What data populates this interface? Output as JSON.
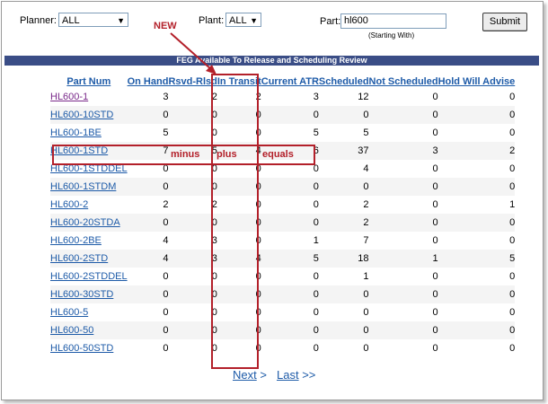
{
  "filters": {
    "planner_label": "Planner:",
    "planner_value": "ALL",
    "plant_label": "Plant:",
    "plant_value": "ALL",
    "part_label": "Part:",
    "part_value": "hl600",
    "part_hint": "(Starting With)",
    "submit_label": "Submit"
  },
  "banner": "FEG Available To Release and Scheduling Review",
  "columns": [
    "Part Num",
    "On Hand",
    "Rsvd-Rlsd",
    "In Transit",
    "Current ATR",
    "Scheduled",
    "Not Scheduled",
    "Hold Will Advise"
  ],
  "rows": [
    [
      "HL600-1",
      "3",
      "2",
      "2",
      "3",
      "12",
      "0",
      "0"
    ],
    [
      "HL600-10STD",
      "0",
      "0",
      "0",
      "0",
      "0",
      "0",
      "0"
    ],
    [
      "HL600-1BE",
      "5",
      "0",
      "0",
      "5",
      "5",
      "0",
      "0"
    ],
    [
      "HL600-1STD",
      "7",
      "5",
      "4",
      "6",
      "37",
      "3",
      "2"
    ],
    [
      "HL600-1STDDEL",
      "0",
      "0",
      "0",
      "0",
      "4",
      "0",
      "0"
    ],
    [
      "HL600-1STDM",
      "0",
      "0",
      "0",
      "0",
      "0",
      "0",
      "0"
    ],
    [
      "HL600-2",
      "2",
      "2",
      "0",
      "0",
      "2",
      "0",
      "1"
    ],
    [
      "HL600-20STDA",
      "0",
      "0",
      "0",
      "0",
      "2",
      "0",
      "0"
    ],
    [
      "HL600-2BE",
      "4",
      "3",
      "0",
      "1",
      "7",
      "0",
      "0"
    ],
    [
      "HL600-2STD",
      "4",
      "3",
      "4",
      "5",
      "18",
      "1",
      "5"
    ],
    [
      "HL600-2STDDEL",
      "0",
      "0",
      "0",
      "0",
      "1",
      "0",
      "0"
    ],
    [
      "HL600-30STD",
      "0",
      "0",
      "0",
      "0",
      "0",
      "0",
      "0"
    ],
    [
      "HL600-5",
      "0",
      "0",
      "0",
      "0",
      "0",
      "0",
      "0"
    ],
    [
      "HL600-50",
      "0",
      "0",
      "0",
      "0",
      "0",
      "0",
      "0"
    ],
    [
      "HL600-50STD",
      "0",
      "0",
      "0",
      "0",
      "0",
      "0",
      "0"
    ]
  ],
  "annotations": {
    "new": "NEW",
    "minus": "minus",
    "plus": "plus",
    "equals": "equals",
    "color": "#b3202a"
  },
  "pager": {
    "next": "Next",
    "next_arrow": ">",
    "last": "Last",
    "last_arrow": ">>"
  },
  "colors": {
    "banner": "#3a4d86",
    "link": "#1e5ba8",
    "visited": "#7a2a8a"
  }
}
